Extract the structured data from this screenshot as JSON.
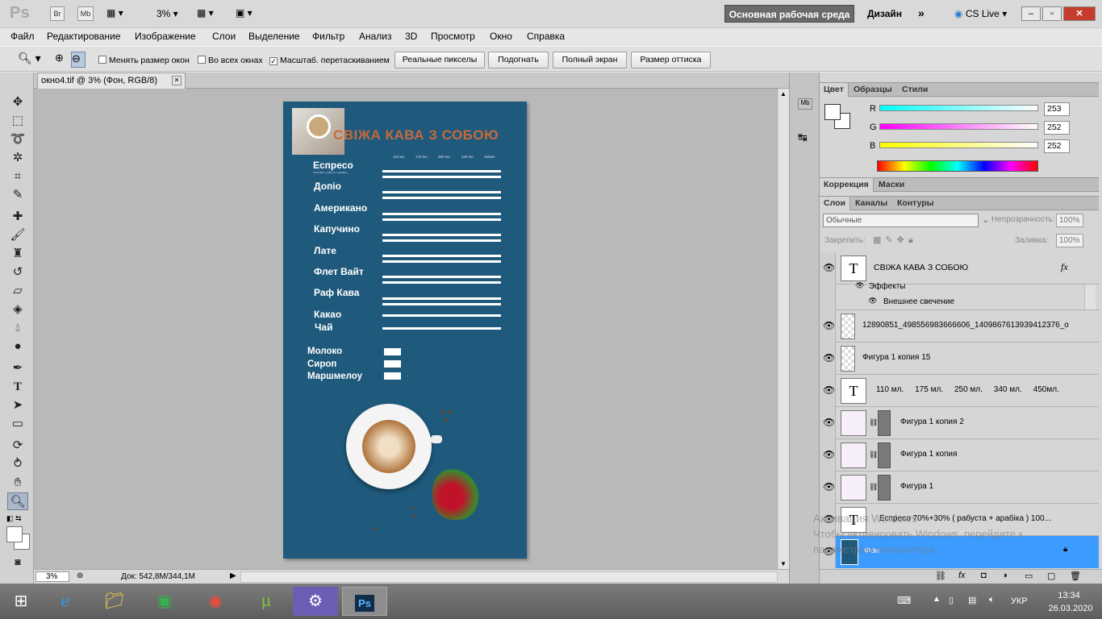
{
  "app": {
    "logo": "Ps",
    "bridge_label": "Br",
    "minibridge_label": "Mb",
    "zoom_value": "3%",
    "workspace_label": "Основная рабочая среда",
    "design_label": "Дизайн",
    "more_label": "»",
    "cslive_label": "CS Live",
    "win_min": "–",
    "win_max": "▫",
    "win_close": "✕"
  },
  "menu": [
    "Файл",
    "Редактирование",
    "Изображение",
    "Слои",
    "Выделение",
    "Фильтр",
    "Анализ",
    "3D",
    "Просмотр",
    "Окно",
    "Справка"
  ],
  "options": {
    "resize_windows": "Менять размер окон",
    "all_windows": "Во всех окнах",
    "scrubby_zoom": "Масштаб. перетаскиванием",
    "actual_pixels": "Реальные пикселы",
    "fit_screen": "Подогнать",
    "fill_screen": "Полный экран",
    "print_size": "Размер оттиска"
  },
  "document": {
    "tab_title": "окно4.tif @ 3% (Фон, RGB/8)",
    "tab_close": "✕",
    "status_zoom": "3%",
    "status_doc": "Док: 542,8M/344,1M"
  },
  "artwork": {
    "headline": "СВІЖА КАВА З СОБОЮ",
    "sizes": [
      "110 мл.",
      "175 мл.",
      "250 мл.",
      "340 мл.",
      "450мл."
    ],
    "drinks": [
      "Еспресо",
      "Допіо",
      "Американо",
      "Капучино",
      "Лате",
      "Флет Вайт",
      "Раф Кава",
      "Какао",
      "Чай"
    ],
    "drink_note": "70%+30% ( рабуста + арабіка )",
    "extras": [
      "Молоко",
      "Сироп",
      "Маршмелоу"
    ],
    "colors": {
      "background": "#1f5a7c",
      "headline": "#c8693a"
    }
  },
  "color_panel": {
    "tabs": [
      "Цвет",
      "Образцы",
      "Стили"
    ],
    "channels": [
      {
        "label": "R",
        "value": "253"
      },
      {
        "label": "G",
        "value": "252"
      },
      {
        "label": "B",
        "value": "252"
      }
    ]
  },
  "adjust_panel": {
    "tabs": [
      "Коррекция",
      "Маски"
    ]
  },
  "layers_panel": {
    "tabs": [
      "Слои",
      "Каналы",
      "Контуры"
    ],
    "blend_mode": "Обычные",
    "opacity_label": "Непрозрачность:",
    "opacity_value": "100%",
    "lock_label": "Закрепить:",
    "fill_label": "Заливка:",
    "fill_value": "100%",
    "layers": [
      {
        "name": "СВІЖА КАВА З СОБОЮ",
        "fx": "fx"
      },
      {
        "name": "Эффекты"
      },
      {
        "name": "Внешнее свечение"
      },
      {
        "name": "12890851_498556983666606_1409867613939412376_o"
      },
      {
        "name": "Фигура 1 копия 15"
      },
      {
        "name": "110 мл.     175 мл.     250 мл.     340 мл.     450мл."
      },
      {
        "name": "Фигура 1 копия 2"
      },
      {
        "name": "Фигура 1 копия"
      },
      {
        "name": "Фигура 1"
      },
      {
        "name": "Еспресо    70%+30% ( рабуста + арабіка )     100..."
      },
      {
        "name": "Фон"
      }
    ]
  },
  "watermark": {
    "line1": "Активация Windows",
    "line2": "Чтобы активировать Windows, перейдите к",
    "line3": "параметрам компьютера."
  },
  "taskbar": {
    "lang": "УКР",
    "time": "13:34",
    "date": "26.03.2020"
  }
}
